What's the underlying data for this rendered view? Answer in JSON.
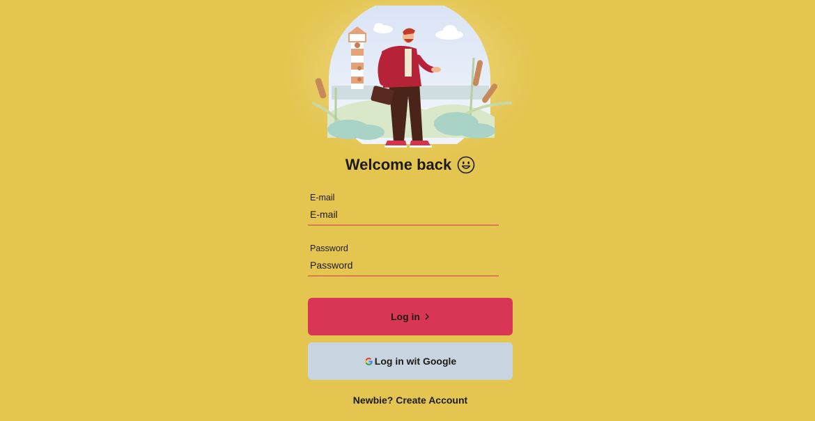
{
  "hero": {
    "illustration": "businessman-walking-lighthouse-illustration"
  },
  "welcome": {
    "title": "Welcome back",
    "emoji_icon": "smiling-face-icon"
  },
  "form": {
    "email": {
      "label": "E-mail",
      "value": "",
      "placeholder": "E-mail"
    },
    "password": {
      "label": "Password",
      "value": "",
      "placeholder": "Password"
    }
  },
  "buttons": {
    "login_label": "Log in",
    "login_icon": "chevron-right-icon",
    "google_label": "Log in wit Google",
    "google_icon": "google-logo-icon"
  },
  "links": {
    "create_account": "Newbie? Create Account"
  },
  "colors": {
    "background": "#e4c550",
    "primary": "#d93655",
    "secondary": "#c8d5e0",
    "text": "#1d1a14"
  }
}
